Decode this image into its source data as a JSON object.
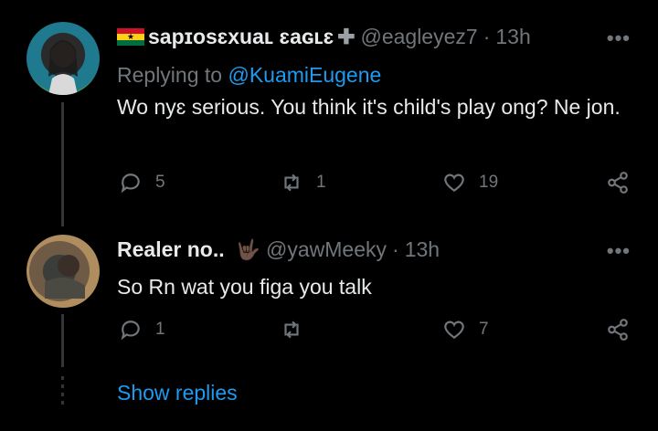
{
  "tweets": [
    {
      "display_name": "sapɪosɛxuaʟ ɛaɢʟɛ",
      "handle": "@eagleyez7",
      "separator": "·",
      "time": "13h",
      "replying_prefix": "Replying to",
      "replying_to": "@KuamiEugene",
      "text": "Wo nyɛ serious. You think it's child's play ong? Ne jon.",
      "more": "•••",
      "replies": "5",
      "retweets": "1",
      "likes": "19",
      "flag": {
        "red": "#ce1126",
        "gold": "#fcd116",
        "green": "#006b3f"
      }
    },
    {
      "display_name": "Realer no..",
      "emoji": "🤟🏿",
      "handle": "@yawMeeky",
      "separator": "·",
      "time": "13h",
      "text": "So Rn wat you figa you talk",
      "more": "•••",
      "replies": "1",
      "retweets": "",
      "likes": "7"
    }
  ],
  "show_replies": "Show replies",
  "icons": [
    "reply-icon",
    "retweet-icon",
    "like-icon",
    "share-icon",
    "more-icon",
    "flag-icon",
    "plus-icon"
  ],
  "colors": {
    "background": "#000000",
    "text": "#e7e9ea",
    "muted": "#71767b",
    "link": "#1d9bf0",
    "thread_line": "#333639"
  }
}
